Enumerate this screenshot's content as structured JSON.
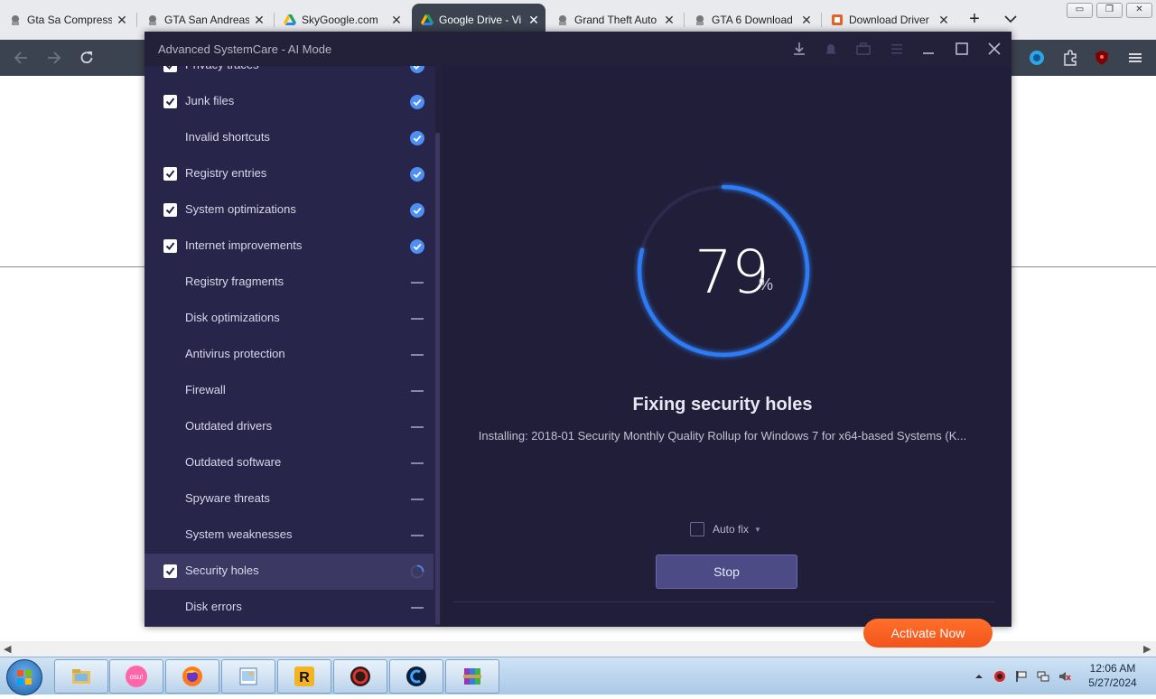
{
  "browser": {
    "tabs": [
      {
        "label": "Gta Sa Compress",
        "active": false
      },
      {
        "label": "GTA San Andreas",
        "active": false
      },
      {
        "label": "SkyGoogle.com",
        "active": false
      },
      {
        "label": "Google Drive - Vi",
        "active": true
      },
      {
        "label": "Grand Theft Auto",
        "active": false
      },
      {
        "label": "GTA 6 Download",
        "active": false
      },
      {
        "label": "Download Driver",
        "active": false
      }
    ],
    "new_tab_label": "+",
    "tab_close_glyph": "✕",
    "win_min": "▭",
    "win_restore": "❐",
    "win_close": "✕"
  },
  "app": {
    "title": "Advanced SystemCare - AI Mode",
    "items": [
      {
        "label": "Privacy traces",
        "checked": true,
        "status": "done"
      },
      {
        "label": "Junk files",
        "checked": true,
        "status": "done"
      },
      {
        "label": "Invalid shortcuts",
        "checked": false,
        "status": "done"
      },
      {
        "label": "Registry entries",
        "checked": true,
        "status": "done"
      },
      {
        "label": "System optimizations",
        "checked": true,
        "status": "done"
      },
      {
        "label": "Internet improvements",
        "checked": true,
        "status": "done"
      },
      {
        "label": "Registry fragments",
        "checked": false,
        "status": "pending"
      },
      {
        "label": "Disk optimizations",
        "checked": false,
        "status": "pending"
      },
      {
        "label": "Antivirus protection",
        "checked": false,
        "status": "pending"
      },
      {
        "label": "Firewall",
        "checked": false,
        "status": "pending"
      },
      {
        "label": "Outdated drivers",
        "checked": false,
        "status": "pending"
      },
      {
        "label": "Outdated software",
        "checked": false,
        "status": "pending"
      },
      {
        "label": "Spyware threats",
        "checked": false,
        "status": "pending"
      },
      {
        "label": "System weaknesses",
        "checked": false,
        "status": "pending"
      },
      {
        "label": "Security holes",
        "checked": true,
        "status": "in-progress"
      },
      {
        "label": "Disk errors",
        "checked": false,
        "status": "pending"
      }
    ],
    "progress": {
      "value": "79",
      "symbol": "%",
      "fraction": 0.79
    },
    "status_title": "Fixing security holes",
    "status_detail": "Installing: 2018-01 Security Monthly Quality Rollup for Windows 7 for x64-based Systems (K...",
    "autofix_label": "Auto fix",
    "stop_label": "Stop",
    "activate_label": "Activate Now",
    "colors": {
      "accent": "#2f7bf5",
      "activate": "#f2541b",
      "window_bg": "#23213a"
    }
  },
  "taskbar": {
    "apps": [
      "file-explorer-icon",
      "osu-icon",
      "firefox-icon",
      "paint-icon",
      "rockstar-icon",
      "driver-booster-icon",
      "ccleaner-icon",
      "winrar-icon"
    ],
    "osu_label": "osu!",
    "rockstar_label": "R",
    "time": "12:06 AM",
    "date": "5/27/2024"
  }
}
